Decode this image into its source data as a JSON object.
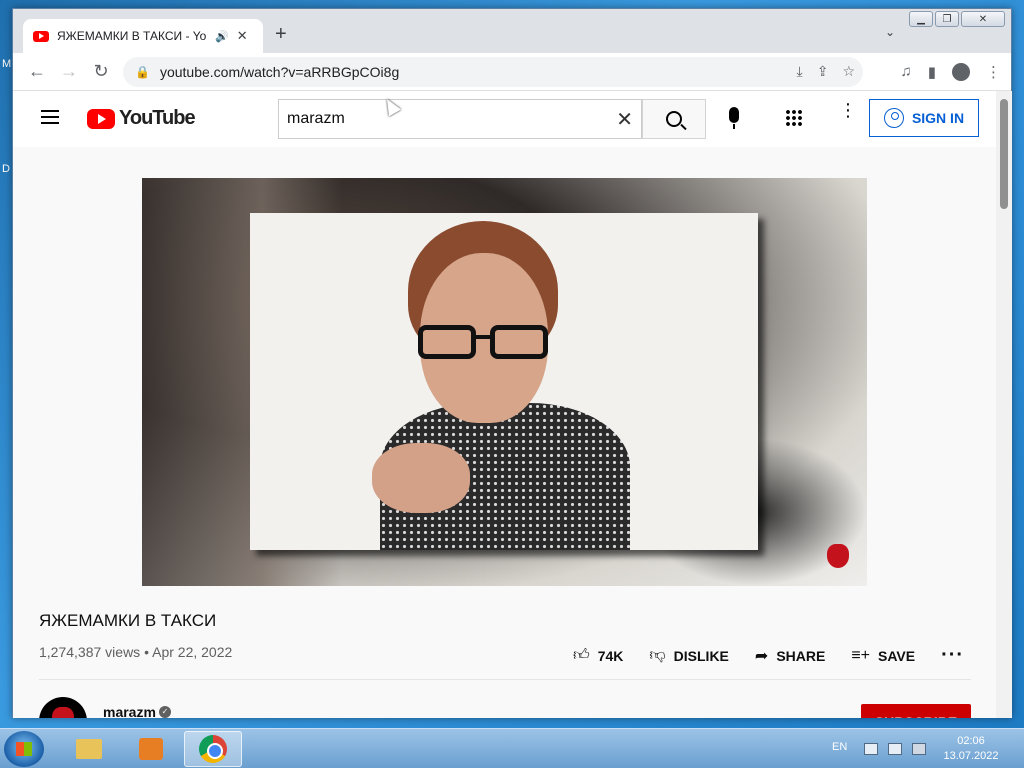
{
  "desktop": {
    "frag1": "M",
    "frag2": "D"
  },
  "browser": {
    "tab_title": "ЯЖЕМАМКИ В ТАКСИ - YouTube",
    "url": "youtube.com/watch?v=aRRBGpCOi8g"
  },
  "youtube": {
    "logo_text": "YouTube",
    "search_value": "marazm",
    "sign_in": "SIGN IN"
  },
  "video": {
    "title": "ЯЖЕМАМКИ В ТАКСИ",
    "views": "1,274,387 views",
    "separator": "•",
    "date": "Apr 22, 2022",
    "likes": "74K",
    "dislike": "DISLIKE",
    "share": "SHARE",
    "save": "SAVE"
  },
  "channel": {
    "name": "marazm",
    "subscribe": "SUBSCRIBE"
  },
  "taskbar": {
    "lang": "EN",
    "time": "02:06",
    "date": "13.07.2022"
  },
  "colors": {
    "youtube_red": "#ff0000",
    "subscribe_red": "#cc0000",
    "link_blue": "#065fd4"
  }
}
